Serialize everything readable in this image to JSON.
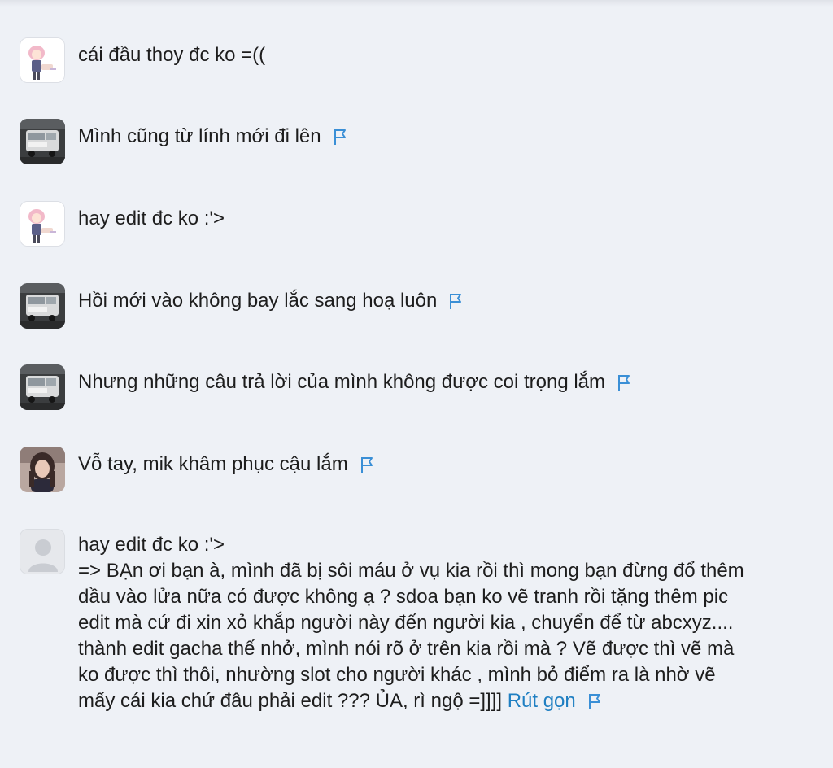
{
  "comments": [
    {
      "avatar": "anime-girl-avatar",
      "text": "cái đầu thoy đc ko =((",
      "flag": false
    },
    {
      "avatar": "truck-photo-avatar",
      "text": "Mình cũng từ lính mới đi lên",
      "flag": true
    },
    {
      "avatar": "anime-girl-avatar",
      "text": "hay edit đc ko :'>",
      "flag": false
    },
    {
      "avatar": "truck-photo-avatar",
      "text": "Hồi mới vào không bay lắc sang hoạ luôn",
      "flag": true
    },
    {
      "avatar": "truck-photo-avatar",
      "text": "Nhưng những câu trả lời của mình không được coi trọng lắm",
      "flag": true
    },
    {
      "avatar": "girl-portrait-avatar",
      "text": "Vỗ tay, mik khâm phục cậu lắm",
      "flag": true
    },
    {
      "avatar": "default-user-avatar",
      "lines": [
        "hay edit đc ko :'>",
        "=> BẠn ơi bạn à, mình đã bị sôi máu ở vụ kia rồi thì mong bạn đừng đổ thêm",
        "dầu vào lửa nữa có được không ạ ? sdoa bạn ko vẽ tranh rồi tặng thêm pic",
        "edit mà cứ đi xin xỏ khắp người này đến người kia , chuyển để từ abcxyz....",
        "thành edit gacha thế nhở, mình nói rõ ở trên kia rồi mà ? Vẽ được thì vẽ mà",
        "ko được thì thôi, nhường slot cho người khác , mình bỏ điểm ra là nhờ vẽ",
        "mấy cái kia chứ đâu phải edit ??? ỦA, rì ngộ =]]]]"
      ],
      "collapse_label": "Rút gọn",
      "flag": true
    }
  ],
  "colors": {
    "background": "#eef1f6",
    "link": "#1f7fc2",
    "flag": "#3a8fd6"
  },
  "icons": {
    "flag": "report-flag-icon"
  }
}
